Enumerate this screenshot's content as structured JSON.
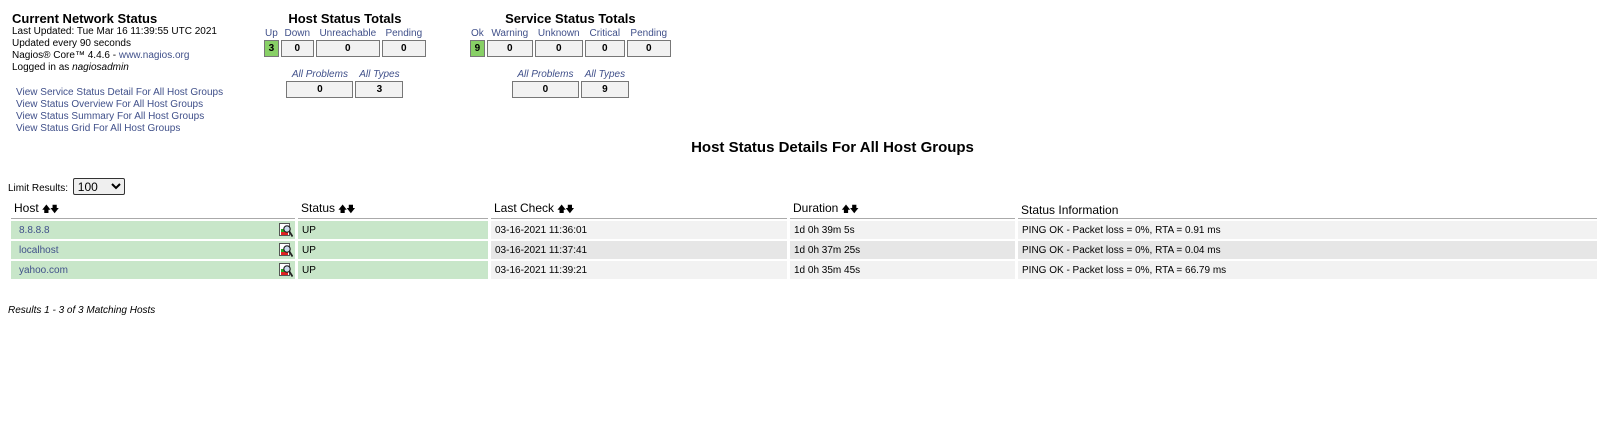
{
  "info": {
    "title": "Current Network Status",
    "last_updated": "Last Updated: Tue Mar 16 11:39:55 UTC 2021",
    "update_interval": "Updated every 90 seconds",
    "version_prefix": "Nagios® Core™ 4.4.6 - ",
    "version_link": "www.nagios.org",
    "logged_prefix": "Logged in as ",
    "user": "nagiosadmin"
  },
  "links": [
    "View Service Status Detail For All Host Groups",
    "View Status Overview For All Host Groups",
    "View Status Summary For All Host Groups",
    "View Status Grid For All Host Groups"
  ],
  "host_totals": {
    "title": "Host Status Totals",
    "labels": [
      "Up",
      "Down",
      "Unreachable",
      "Pending"
    ],
    "values": [
      "3",
      "0",
      "0",
      "0"
    ],
    "problem_labels": [
      "All Problems",
      "All Types"
    ],
    "problem_values": [
      "0",
      "3"
    ]
  },
  "service_totals": {
    "title": "Service Status Totals",
    "labels": [
      "Ok",
      "Warning",
      "Unknown",
      "Critical",
      "Pending"
    ],
    "values": [
      "9",
      "0",
      "0",
      "0",
      "0"
    ],
    "problem_labels": [
      "All Problems",
      "All Types"
    ],
    "problem_values": [
      "0",
      "9"
    ]
  },
  "heading": "Host Status Details For All Host Groups",
  "limit": {
    "label": "Limit Results:",
    "value": "100"
  },
  "table": {
    "columns": [
      "Host",
      "Status",
      "Last Check",
      "Duration",
      "Status Information"
    ],
    "rows": [
      {
        "host": "8.8.8.8",
        "status": "UP",
        "last_check": "03-16-2021 11:36:01",
        "duration": "1d 0h 39m 5s",
        "info": "PING OK - Packet loss = 0%, RTA = 0.91 ms"
      },
      {
        "host": "localhost",
        "status": "UP",
        "last_check": "03-16-2021 11:37:41",
        "duration": "1d 0h 37m 25s",
        "info": "PING OK - Packet loss = 0%, RTA = 0.04 ms"
      },
      {
        "host": "yahoo.com",
        "status": "UP",
        "last_check": "03-16-2021 11:39:21",
        "duration": "1d 0h 35m 45s",
        "info": "PING OK - Packet loss = 0%, RTA = 66.79 ms"
      }
    ]
  },
  "results": "Results 1 - 3 of 3 Matching Hosts",
  "colors": {
    "up": "#c8e6c9",
    "ok_cell": "#88d066",
    "link": "#40508a"
  }
}
